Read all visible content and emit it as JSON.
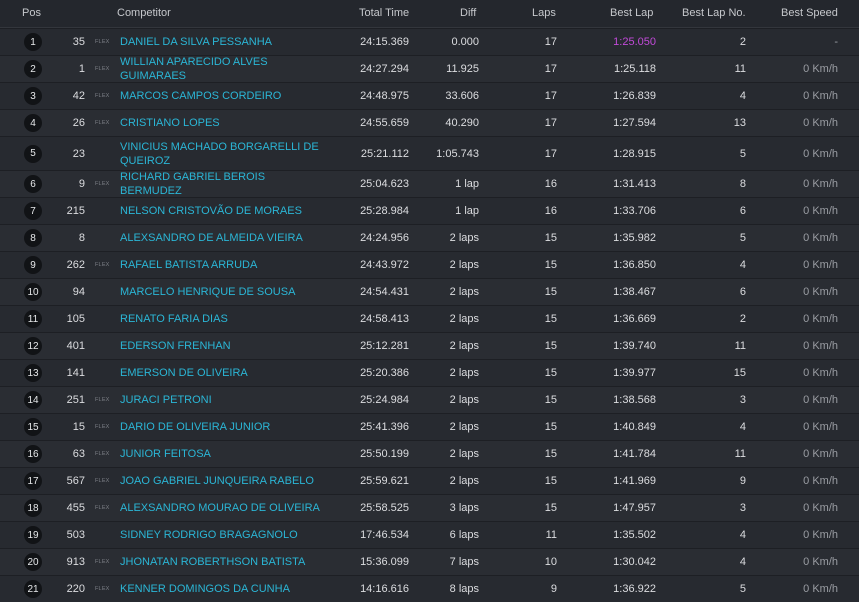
{
  "headers": {
    "pos": "Pos",
    "competitor": "Competitor",
    "total_time": "Total Time",
    "diff": "Diff",
    "laps": "Laps",
    "best_lap": "Best Lap",
    "best_lap_no": "Best Lap No.",
    "best_speed": "Best Speed"
  },
  "colors": {
    "name": "#2bb6d6",
    "fastest_lap": "#c24ad9",
    "background": "#1d1f24"
  },
  "rows": [
    {
      "pos": "1",
      "number": "35",
      "flex": "FLEX",
      "name": "DANIEL DA SILVA PESSANHA",
      "total": "24:15.369",
      "diff": "0.000",
      "laps": "17",
      "best": "1:25.050",
      "best_no": "2",
      "speed": "-",
      "fastest": true
    },
    {
      "pos": "2",
      "number": "1",
      "flex": "FLEX",
      "name": "WILLIAN APARECIDO ALVES GUIMARAES",
      "total": "24:27.294",
      "diff": "11.925",
      "laps": "17",
      "best": "1:25.118",
      "best_no": "11",
      "speed": "0 Km/h"
    },
    {
      "pos": "3",
      "number": "42",
      "flex": "FLEX",
      "name": "MARCOS CAMPOS CORDEIRO",
      "total": "24:48.975",
      "diff": "33.606",
      "laps": "17",
      "best": "1:26.839",
      "best_no": "4",
      "speed": "0 Km/h"
    },
    {
      "pos": "4",
      "number": "26",
      "flex": "FLEX",
      "name": "CRISTIANO LOPES",
      "total": "24:55.659",
      "diff": "40.290",
      "laps": "17",
      "best": "1:27.594",
      "best_no": "13",
      "speed": "0 Km/h"
    },
    {
      "pos": "5",
      "number": "23",
      "flex": "",
      "name": "VINICIUS MACHADO BORGARELLI DE QUEIROZ",
      "total": "25:21.112",
      "diff": "1:05.743",
      "laps": "17",
      "best": "1:28.915",
      "best_no": "5",
      "speed": "0 Km/h",
      "tall": true
    },
    {
      "pos": "6",
      "number": "9",
      "flex": "FLEX",
      "name": "RICHARD GABRIEL BEROIS BERMUDEZ",
      "total": "25:04.623",
      "diff": "1 lap",
      "laps": "16",
      "best": "1:31.413",
      "best_no": "8",
      "speed": "0 Km/h"
    },
    {
      "pos": "7",
      "number": "215",
      "flex": "",
      "name": "NELSON CRISTOVÃO DE MORAES",
      "total": "25:28.984",
      "diff": "1 lap",
      "laps": "16",
      "best": "1:33.706",
      "best_no": "6",
      "speed": "0 Km/h"
    },
    {
      "pos": "8",
      "number": "8",
      "flex": "",
      "name": "ALEXSANDRO DE ALMEIDA VIEIRA",
      "total": "24:24.956",
      "diff": "2 laps",
      "laps": "15",
      "best": "1:35.982",
      "best_no": "5",
      "speed": "0 Km/h"
    },
    {
      "pos": "9",
      "number": "262",
      "flex": "FLEX",
      "name": "RAFAEL BATISTA ARRUDA",
      "total": "24:43.972",
      "diff": "2 laps",
      "laps": "15",
      "best": "1:36.850",
      "best_no": "4",
      "speed": "0 Km/h"
    },
    {
      "pos": "10",
      "number": "94",
      "flex": "",
      "name": "MARCELO HENRIQUE DE SOUSA",
      "total": "24:54.431",
      "diff": "2 laps",
      "laps": "15",
      "best": "1:38.467",
      "best_no": "6",
      "speed": "0 Km/h"
    },
    {
      "pos": "11",
      "number": "105",
      "flex": "",
      "name": "RENATO FARIA DIAS",
      "total": "24:58.413",
      "diff": "2 laps",
      "laps": "15",
      "best": "1:36.669",
      "best_no": "2",
      "speed": "0 Km/h"
    },
    {
      "pos": "12",
      "number": "401",
      "flex": "",
      "name": "EDERSON FRENHAN",
      "total": "25:12.281",
      "diff": "2 laps",
      "laps": "15",
      "best": "1:39.740",
      "best_no": "11",
      "speed": "0 Km/h"
    },
    {
      "pos": "13",
      "number": "141",
      "flex": "",
      "name": "EMERSON DE OLIVEIRA",
      "total": "25:20.386",
      "diff": "2 laps",
      "laps": "15",
      "best": "1:39.977",
      "best_no": "15",
      "speed": "0 Km/h"
    },
    {
      "pos": "14",
      "number": "251",
      "flex": "FLEX",
      "name": "JURACI PETRONI",
      "total": "25:24.984",
      "diff": "2 laps",
      "laps": "15",
      "best": "1:38.568",
      "best_no": "3",
      "speed": "0 Km/h"
    },
    {
      "pos": "15",
      "number": "15",
      "flex": "FLEX",
      "name": "DARIO DE OLIVEIRA JUNIOR",
      "total": "25:41.396",
      "diff": "2 laps",
      "laps": "15",
      "best": "1:40.849",
      "best_no": "4",
      "speed": "0 Km/h"
    },
    {
      "pos": "16",
      "number": "63",
      "flex": "FLEX",
      "name": "JUNIOR FEITOSA",
      "total": "25:50.199",
      "diff": "2 laps",
      "laps": "15",
      "best": "1:41.784",
      "best_no": "11",
      "speed": "0 Km/h"
    },
    {
      "pos": "17",
      "number": "567",
      "flex": "FLEX",
      "name": "JOAO GABRIEL JUNQUEIRA RABELO",
      "total": "25:59.621",
      "diff": "2 laps",
      "laps": "15",
      "best": "1:41.969",
      "best_no": "9",
      "speed": "0 Km/h"
    },
    {
      "pos": "18",
      "number": "455",
      "flex": "FLEX",
      "name": "ALEXSANDRO MOURAO DE OLIVEIRA",
      "total": "25:58.525",
      "diff": "3 laps",
      "laps": "15",
      "best": "1:47.957",
      "best_no": "3",
      "speed": "0 Km/h"
    },
    {
      "pos": "19",
      "number": "503",
      "flex": "",
      "name": "SIDNEY RODRIGO BRAGAGNOLO",
      "total": "17:46.534",
      "diff": "6 laps",
      "laps": "11",
      "best": "1:35.502",
      "best_no": "4",
      "speed": "0 Km/h"
    },
    {
      "pos": "20",
      "number": "913",
      "flex": "FLEX",
      "name": "JHONATAN ROBERTHSON BATISTA",
      "total": "15:36.099",
      "diff": "7 laps",
      "laps": "10",
      "best": "1:30.042",
      "best_no": "4",
      "speed": "0 Km/h"
    },
    {
      "pos": "21",
      "number": "220",
      "flex": "FLEX",
      "name": "KENNER DOMINGOS DA CUNHA",
      "total": "14:16.616",
      "diff": "8 laps",
      "laps": "9",
      "best": "1:36.922",
      "best_no": "5",
      "speed": "0 Km/h"
    }
  ]
}
